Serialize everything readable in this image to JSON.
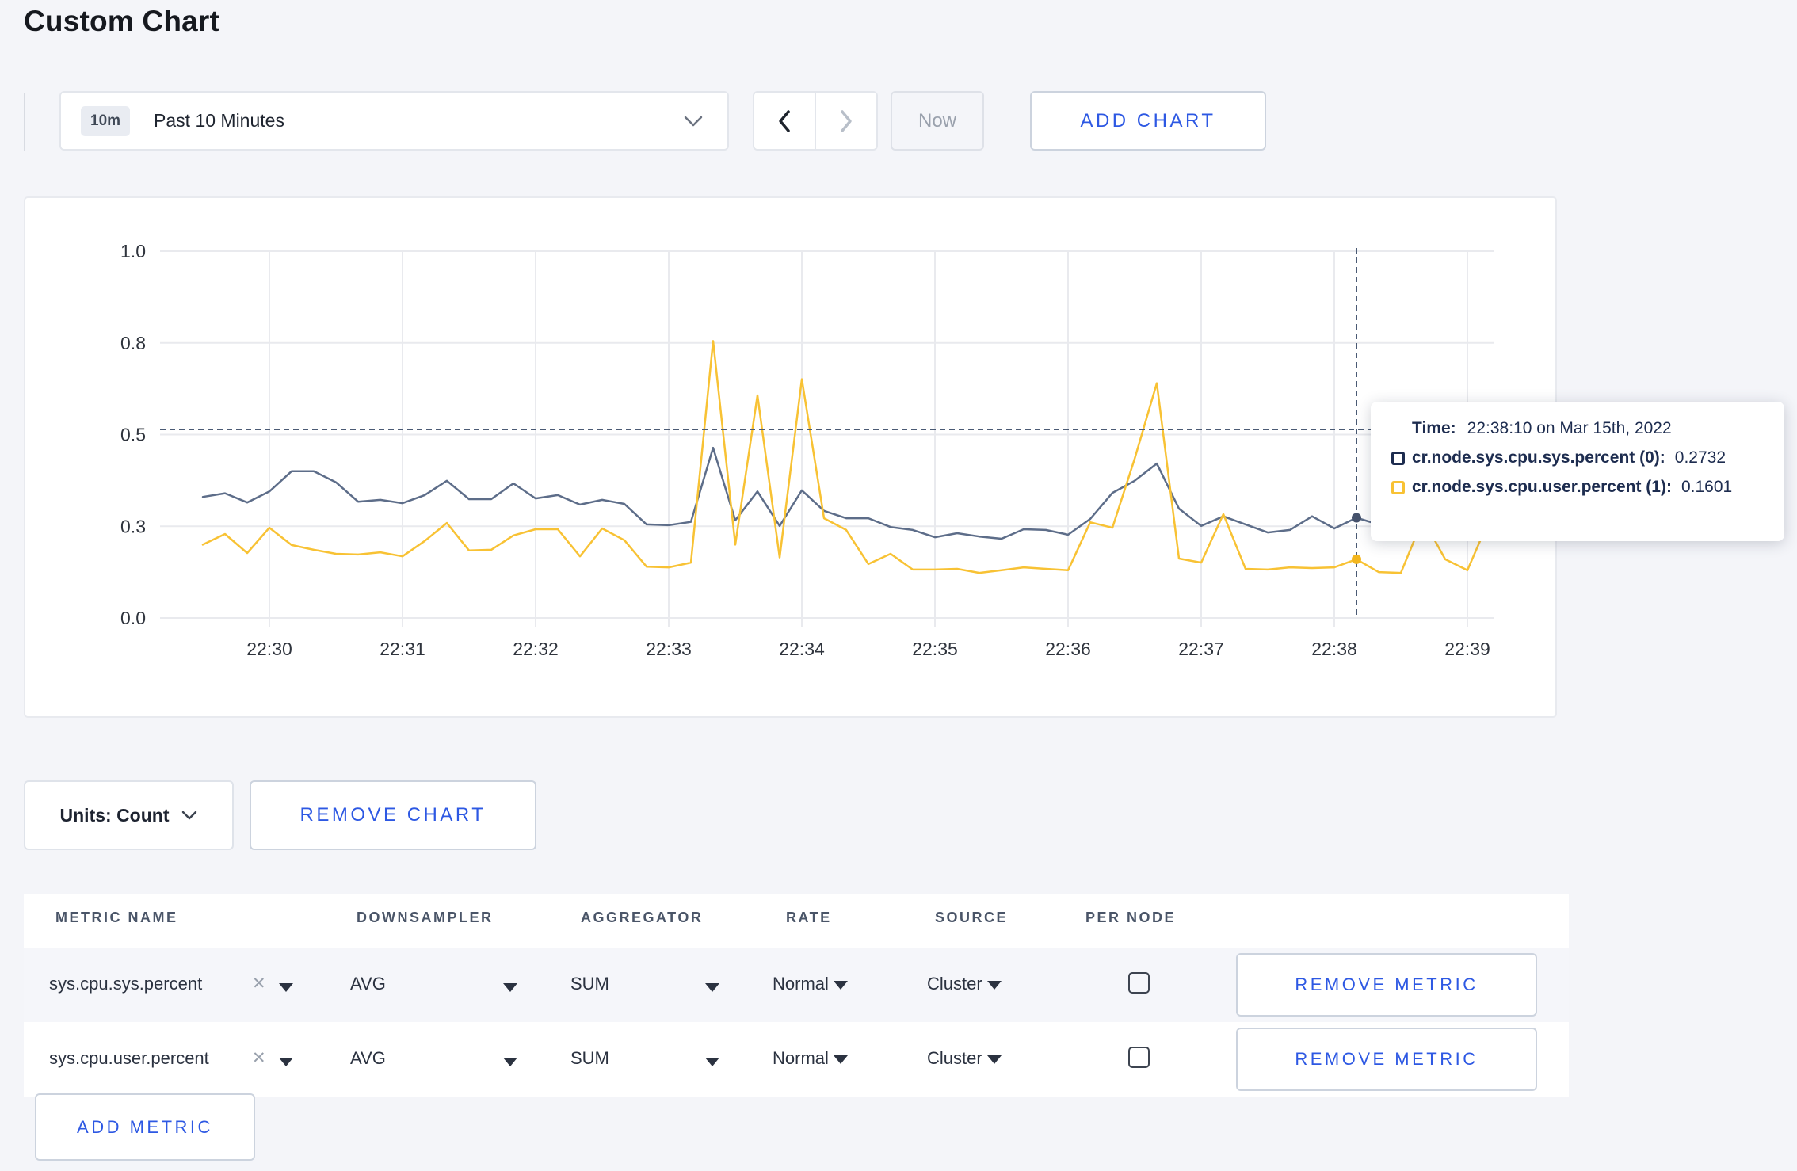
{
  "page": {
    "title": "Custom Chart",
    "background": "#f4f5f9",
    "accent_blue": "#2d58e3"
  },
  "toolbar": {
    "time_window_badge": "10m",
    "time_window_label": "Past 10 Minutes",
    "now_label": "Now",
    "add_chart_label": "ADD CHART"
  },
  "chart_data": {
    "type": "line",
    "title": "",
    "x_axis": {
      "tick_labels": [
        "22:30",
        "22:31",
        "22:32",
        "22:33",
        "22:34",
        "22:35",
        "22:36",
        "22:37",
        "22:38",
        "22:39"
      ],
      "start_time": "22:29:30",
      "interval_seconds": 10
    },
    "y_axis": {
      "tick_labels": [
        "0.0",
        "0.3",
        "0.5",
        "0.8",
        "1.0"
      ],
      "tick_values": [
        0,
        0.25,
        0.5,
        0.75,
        1.0
      ],
      "range": [
        0,
        1
      ],
      "grid": true
    },
    "legend_position": "tooltip-only",
    "series": [
      {
        "name": "cr.node.sys.cpu.sys.percent (0)",
        "color": "#5d6d89",
        "values": [
          0.33,
          0.34,
          0.315,
          0.345,
          0.4,
          0.4,
          0.37,
          0.317,
          0.322,
          0.313,
          0.335,
          0.374,
          0.324,
          0.324,
          0.367,
          0.326,
          0.335,
          0.309,
          0.322,
          0.311,
          0.255,
          0.253,
          0.262,
          0.464,
          0.266,
          0.345,
          0.251,
          0.348,
          0.292,
          0.272,
          0.272,
          0.248,
          0.24,
          0.22,
          0.231,
          0.222,
          0.216,
          0.242,
          0.24,
          0.227,
          0.27,
          0.341,
          0.374,
          0.421,
          0.298,
          0.251,
          0.277,
          0.255,
          0.233,
          0.24,
          0.277,
          0.244,
          0.2732,
          0.255,
          0.25,
          0.268,
          0.258,
          0.305,
          0.298
        ]
      },
      {
        "name": "cr.node.sys.cpu.user.percent (1)",
        "color": "#f8c234",
        "values": [
          0.2,
          0.229,
          0.177,
          0.246,
          0.199,
          0.186,
          0.175,
          0.173,
          0.179,
          0.168,
          0.21,
          0.259,
          0.184,
          0.186,
          0.225,
          0.242,
          0.242,
          0.168,
          0.244,
          0.212,
          0.14,
          0.138,
          0.151,
          0.755,
          0.2,
          0.607,
          0.165,
          0.651,
          0.272,
          0.24,
          0.147,
          0.175,
          0.132,
          0.132,
          0.134,
          0.123,
          0.13,
          0.138,
          0.134,
          0.13,
          0.261,
          0.246,
          0.434,
          0.64,
          0.162,
          0.151,
          0.283,
          0.134,
          0.132,
          0.138,
          0.136,
          0.138,
          0.1601,
          0.125,
          0.123,
          0.27,
          0.16,
          0.13,
          0.27
        ]
      }
    ],
    "crosshair": {
      "time_label": "22:38:10",
      "x_index": 52,
      "y_value": 0.514,
      "highlight": [
        {
          "series": 0,
          "value": 0.2732,
          "dot_color": "#46526c"
        },
        {
          "series": 1,
          "value": 0.1601,
          "dot_color": "#f3b61e"
        }
      ]
    }
  },
  "tooltip": {
    "time_label": "Time:",
    "time_value": "22:38:10 on Mar 15th, 2022",
    "entries": [
      {
        "label": "cr.node.sys.cpu.sys.percent (0):",
        "value": "0.2732",
        "swatch_color": "#1d2c4f"
      },
      {
        "label": "cr.node.sys.cpu.user.percent (1):",
        "value": "0.1601",
        "swatch_color": "#f8c234"
      }
    ]
  },
  "chart_controls": {
    "units_label": "Units: Count",
    "remove_chart_label": "REMOVE CHART"
  },
  "metrics_table": {
    "headers": [
      "METRIC NAME",
      "DOWNSAMPLER",
      "AGGREGATOR",
      "RATE",
      "SOURCE",
      "PER NODE"
    ],
    "rows": [
      {
        "metric": "sys.cpu.sys.percent",
        "remove_symbol": "✕",
        "downsampler": "AVG",
        "aggregator": "SUM",
        "rate": "Normal",
        "source": "Cluster",
        "per_node_checked": false,
        "remove_label": "REMOVE METRIC"
      },
      {
        "metric": "sys.cpu.user.percent",
        "remove_symbol": "✕",
        "downsampler": "AVG",
        "aggregator": "SUM",
        "rate": "Normal",
        "source": "Cluster",
        "per_node_checked": false,
        "remove_label": "REMOVE METRIC"
      }
    ],
    "add_metric_label": "ADD METRIC"
  }
}
